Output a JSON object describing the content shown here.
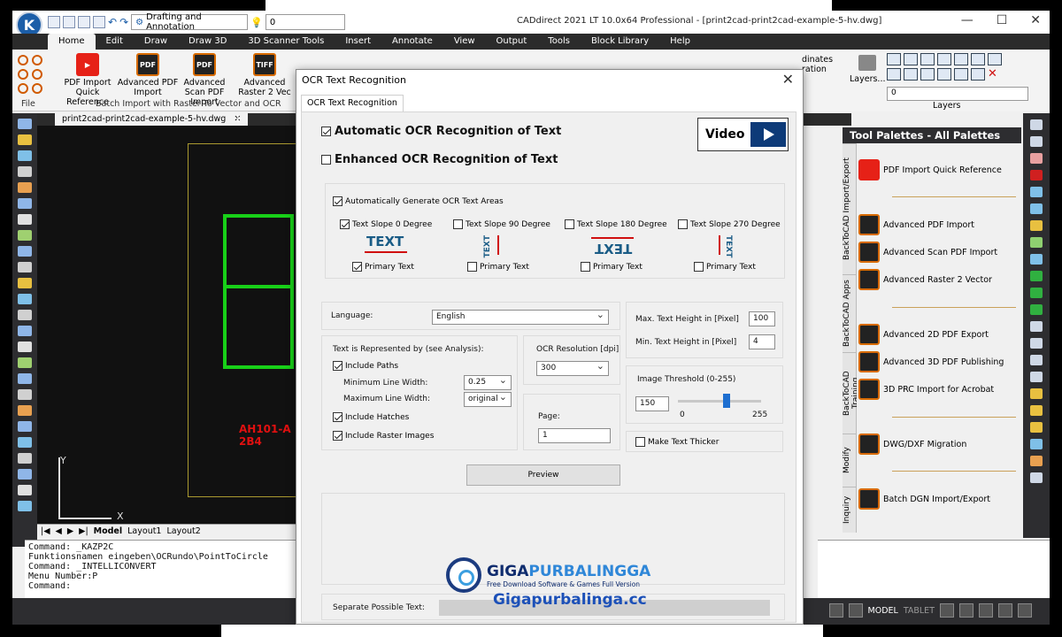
{
  "app": {
    "title": "CADdirect 2021 LT 10.0x64 Professional  - [print2cad-print2cad-example-5-hv.dwg]",
    "workspace": "Drafting and Annotation",
    "layer": "0",
    "logo": "K"
  },
  "ribbon": {
    "tabs": [
      "Home",
      "Edit",
      "Draw",
      "Draw 3D",
      "3D Scanner Tools",
      "Insert",
      "Annotate",
      "View",
      "Output",
      "Tools",
      "Block Library",
      "Help"
    ],
    "active_tab": "Home",
    "items": [
      {
        "label": "PDF Import Quick Reference",
        "icon": "youtube-icon"
      },
      {
        "label": "Advanced PDF Import",
        "icon": "pdf-in-icon"
      },
      {
        "label": "Advanced Scan PDF Import",
        "icon": "pdf-in-icon"
      },
      {
        "label": "Advanced Raster 2 Vec",
        "icon": "tiff-in-icon"
      }
    ],
    "group_file": "File",
    "group_batch": "Batch Import with Raster To Vector and OCR",
    "layers_label": "Layers...",
    "layers_group": "Layers",
    "coordinates_label": "dinates ration",
    "layer_value": "0"
  },
  "document": {
    "tab": "print2cad-print2cad-example-5-hv.dwg",
    "layout_tabs": [
      "Model",
      "Layout1",
      "Layout2"
    ],
    "canvas_texts": {
      "title": "AH101-A 2B4",
      "axis_y": "Y",
      "axis_x": "X"
    }
  },
  "command": {
    "lines": [
      "Command: _KAZP2C",
      "Funktionsnamen eingeben\\OCRundo\\PointToCircle",
      "Command: _INTELLICONVERT",
      "Menu Number:P",
      "Command:"
    ]
  },
  "status": {
    "model": "MODEL",
    "tablet": "TABLET"
  },
  "palette": {
    "title": "Tool Palettes - All Palettes",
    "side_tabs": [
      "BackToCAD Import/Export",
      "BackToCAD Apps",
      "BackToCAD Training",
      "Modify",
      "Inquiry"
    ],
    "items": [
      {
        "label": "PDF Import Quick Reference",
        "icon": "youtube-icon"
      },
      {
        "label": "Advanced PDF Import",
        "icon": "pdf-in-icon"
      },
      {
        "label": "Advanced Scan PDF Import",
        "icon": "pdf-in-icon"
      },
      {
        "label": "Advanced Raster 2 Vector",
        "icon": "tiff-in-icon"
      },
      {
        "label": "Advanced 2D PDF Export",
        "icon": "pdf-out-icon"
      },
      {
        "label": "Advanced 3D PDF Publishing",
        "icon": "pdf-out-icon"
      },
      {
        "label": "3D PRC Import for Acrobat",
        "icon": "prc-in-icon"
      },
      {
        "label": "DWG/DXF Migration",
        "icon": "dwg-icon"
      },
      {
        "label": "Batch DGN Import/Export",
        "icon": "dgn-icon"
      }
    ]
  },
  "dialog": {
    "title": "OCR Text Recognition",
    "tab": "OCR Text Recognition",
    "auto_ocr": {
      "label": "Automatic OCR Recognition of Text",
      "checked": true
    },
    "enhanced_ocr": {
      "label": "Enhanced OCR Recognition of Text",
      "checked": false
    },
    "video_label": "Video",
    "auto_areas": {
      "label": "Automatically Generate OCR Text Areas",
      "checked": true
    },
    "slopes": [
      {
        "label": "Text Slope 0 Degree",
        "checked": true,
        "sample": "TEXT",
        "primary": true
      },
      {
        "label": "Text Slope 90 Degree",
        "checked": false,
        "sample": "TEXT",
        "primary": false
      },
      {
        "label": "Text Slope 180 Degree",
        "checked": false,
        "sample": "TEXT",
        "primary": false
      },
      {
        "label": "Text Slope 270 Degree",
        "checked": false,
        "sample": "TEXT",
        "primary": false
      }
    ],
    "primary_label": "Primary Text",
    "language_label": "Language:",
    "language_value": "English",
    "max_height_label": "Max. Text Height in [Pixel]",
    "max_height_value": "100",
    "min_height_label": "Min. Text Height in [Pixel]",
    "min_height_value": "4",
    "represented_label": "Text is Represented by (see Analysis):",
    "include_paths": "Include Paths",
    "min_line_label": "Minimum Line Width:",
    "min_line_value": "0.25",
    "max_line_label": "Maximum Line Width:",
    "max_line_value": "original",
    "include_hatches": "Include Hatches",
    "include_raster": "Include Raster Images",
    "resolution_label": "OCR Resolution [dpi]",
    "resolution_value": "300",
    "threshold_label": "Image Threshold (0-255)",
    "threshold_value": "150",
    "threshold_min": "0",
    "threshold_max": "255",
    "threshold_level": 150,
    "page_label": "Page:",
    "page_value": "1",
    "thicker_label": "Make Text Thicker",
    "preview_label": "Preview",
    "separate_label": "Separate Possible Text:"
  },
  "watermark": {
    "brand_a": "GIGA",
    "brand_b": "PURBALINGGA",
    "tagline": "Free Download Software & Games Full Version",
    "site": "Gigapurbalinga.cc"
  }
}
